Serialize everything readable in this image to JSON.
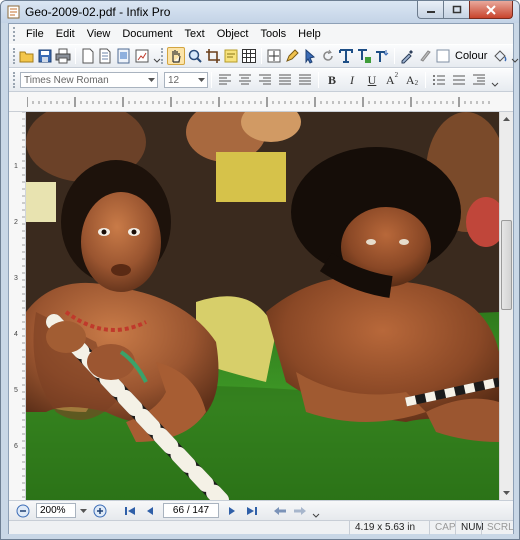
{
  "window": {
    "title": "Geo-2009-02.pdf - Infix Pro"
  },
  "menu": [
    "File",
    "Edit",
    "View",
    "Document",
    "Text",
    "Object",
    "Tools",
    "Help"
  ],
  "toolbar1": {
    "icons": [
      "open-icon",
      "save-icon",
      "print-icon",
      "new-page-icon",
      "copy-page-icon",
      "document-icon",
      "page-settings-icon",
      "hand-tool-icon",
      "zoom-tool-icon",
      "crop-tool-icon",
      "note-icon",
      "grid-icon",
      "fit-page-icon",
      "pen-icon",
      "pointer-icon",
      "rotate-icon",
      "text-tool-icon",
      "text-edit-icon",
      "text-flow-icon",
      "eyedropper-icon",
      "brush-icon",
      "colour-swatch-icon",
      "fill-bucket-icon"
    ],
    "colour_label": "Colour",
    "accent": "#fce4a8"
  },
  "toolbar2": {
    "font_family": "Times New Roman",
    "font_size": "12",
    "buttons": [
      "align-left-icon",
      "align-center-icon",
      "align-right-icon",
      "justify-icon",
      "justify-all-icon",
      "bold",
      "italic",
      "underline",
      "superscript",
      "subscript",
      "bullets-icon",
      "numbering-icon",
      "indent-icon"
    ],
    "bold": "B",
    "italic": "I",
    "underline": "U",
    "superscript": "A",
    "subscript": "A"
  },
  "ruler": {
    "h_numbers": [
      "1",
      "2",
      "3",
      "4",
      "5",
      "6",
      "7",
      "8"
    ],
    "v_numbers": [
      "1",
      "2",
      "3",
      "4",
      "5",
      "6"
    ]
  },
  "navigation": {
    "zoom": "200%",
    "current_page": "66",
    "total_pages": "147",
    "page_display": "66 / 147"
  },
  "status": {
    "dimensions": "4.19 x 5.63 in",
    "cap": "CAP",
    "num": "NUM",
    "scrl": "SCRL"
  }
}
